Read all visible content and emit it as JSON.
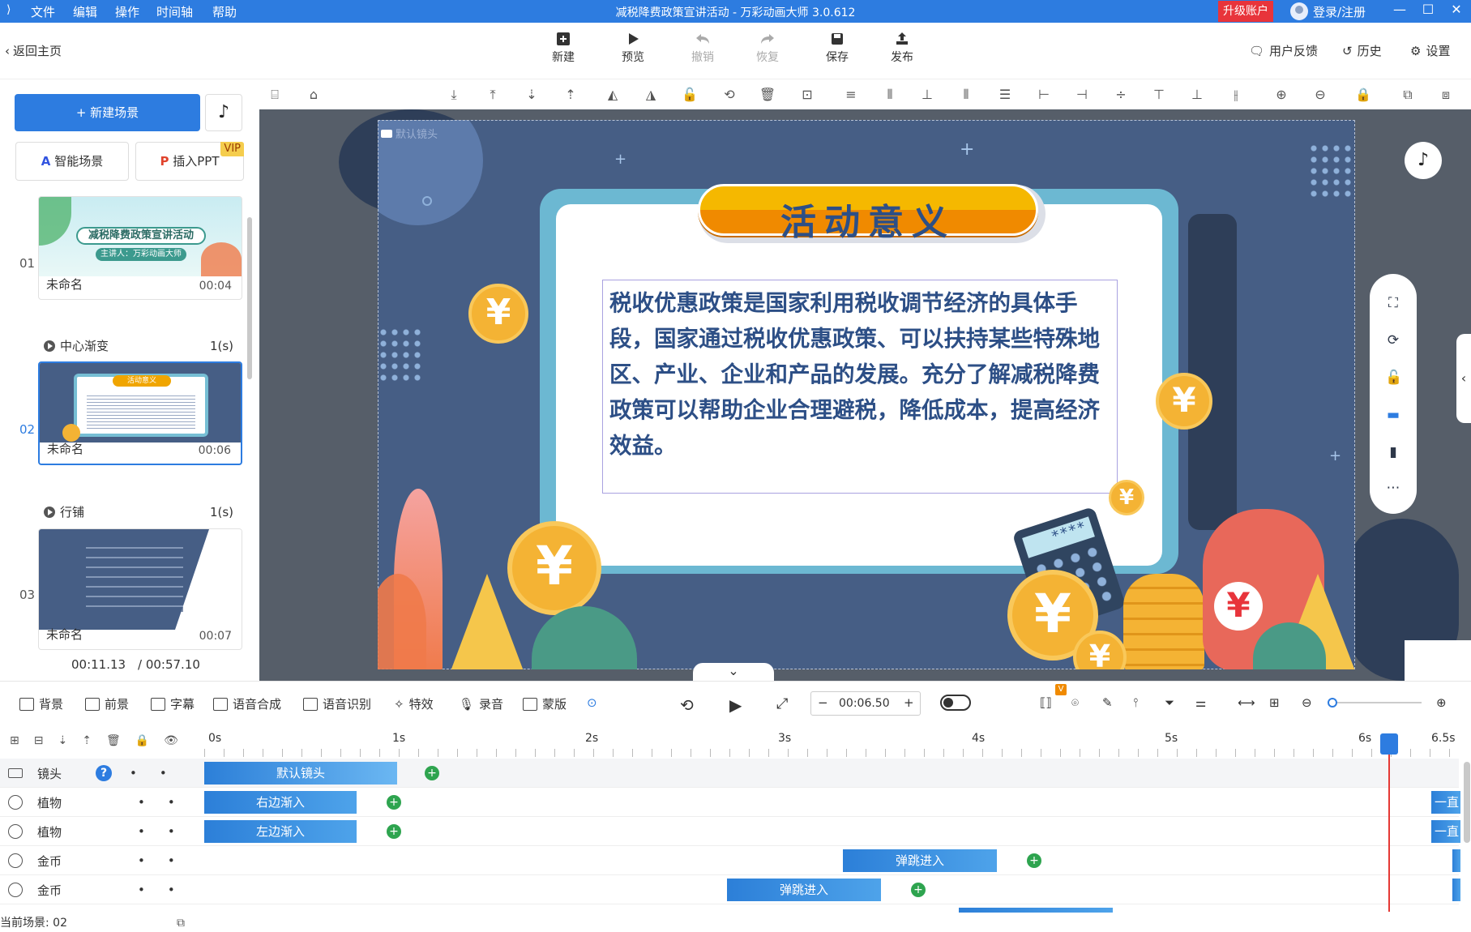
{
  "titlebar": {
    "menus": [
      "文件",
      "编辑",
      "操作",
      "时间轴",
      "帮助"
    ],
    "title": "减税降费政策宣讲活动 - 万彩动画大师 3.0.612",
    "upgrade": "升级账户",
    "login": "登录/注册"
  },
  "toolbar": {
    "back": "返回主页",
    "new": "新建",
    "preview": "预览",
    "undo": "撤销",
    "redo": "恢复",
    "save": "保存",
    "publish": "发布",
    "feedback": "用户反馈",
    "history": "历史",
    "settings": "设置"
  },
  "left": {
    "new_scene": "+ 新建场景",
    "smart_scene": "智能场景",
    "insert_ppt": "插入PPT",
    "vip": "VIP",
    "scenes": [
      {
        "num": "01",
        "name": "未命名",
        "duration": "00:04",
        "thumb_title": "减税降费政策宣讲活动",
        "thumb_sub": "主讲人：万彩动画大师",
        "transition": "中心渐变",
        "transition_time": "1(s)"
      },
      {
        "num": "02",
        "name": "未命名",
        "duration": "00:06",
        "thumb_title": "活动意义",
        "transition": "行铺",
        "transition_time": "1(s)"
      },
      {
        "num": "03",
        "name": "未命名",
        "duration": "00:07"
      }
    ],
    "current_time": "00:11.13",
    "total_time": "/ 00:57.10"
  },
  "canvas": {
    "camera_label": "默认镜头",
    "slide_title": "活动意义",
    "slide_body": "税收优惠政策是国家利用税收调节经济的具体手段，国家通过税收优惠政策、可以扶持某些特殊地区、产业、企业和产品的发展。充分了解减税降费政策可以帮助企业合理避税，降低成本，提高经济效益。",
    "calculator_display": "****",
    "yen": "¥"
  },
  "bottombar": {
    "background": "背景",
    "foreground": "前景",
    "subtitle": "字幕",
    "tts": "语音合成",
    "asr": "语音识别",
    "effects": "特效",
    "record": "录音",
    "mask": "蒙版",
    "time_value": "00:06.50",
    "v_badge": "V"
  },
  "timeline": {
    "ticks": [
      "0s",
      "1s",
      "2s",
      "3s",
      "4s",
      "5s",
      "6s",
      "6.5s"
    ],
    "tracks": [
      {
        "name": "镜头",
        "clip": "默认镜头"
      },
      {
        "name": "植物",
        "clip": "右边渐入",
        "end": "一直"
      },
      {
        "name": "植物",
        "clip": "左边渐入",
        "end": "一直"
      },
      {
        "name": "金币",
        "clip": "弹跳进入"
      },
      {
        "name": "金币",
        "clip": "弹跳进入"
      }
    ],
    "status": "当前场景: 02",
    "help": "?"
  },
  "colors": {
    "accent": "#2d7ce0",
    "upgrade_red": "#e8343b",
    "slide_bg": "#465e85",
    "title_orange": "#f0a500",
    "text_blue": "#2d4f86"
  }
}
